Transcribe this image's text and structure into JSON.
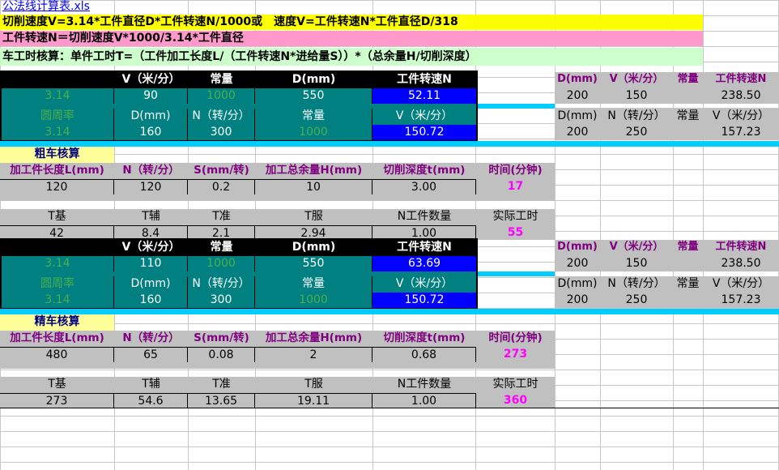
{
  "file_link": "公法线计算表.xls",
  "formula_lines": [
    "切削速度V=3.14*工件直径D*工件转速N/1000或　速度V=工件转速N*工件直径D/318",
    "工件转速N＝切削速度V*1000/3.14*工件直径",
    "车工时核算：单件工时T=（工件加工长度L/（工件转速N*进给量S））*（总余量H/切削深度）"
  ],
  "calc_header": [
    "V（米/分）",
    "常量",
    "D(mm)",
    "工件转速N"
  ],
  "calc_sub_header": [
    "圆周率",
    "D(mm)",
    "N（转/分）",
    "常量",
    "V（米/分）"
  ],
  "side_header1": [
    "D(mm)",
    "V（米/分）",
    "常量",
    "工件转速N"
  ],
  "side_header2": [
    "D(mm)",
    "N（转/分）",
    "常量",
    "V（米/分）"
  ],
  "rough": {
    "title": "粗车核算",
    "calc1": [
      "3.14",
      "90",
      "1000",
      "550",
      "52.11"
    ],
    "calc2": [
      "3.14",
      "160",
      "300",
      "1000",
      "150.72"
    ],
    "side1": [
      "200",
      "150",
      "",
      "238.50"
    ],
    "side2": [
      "200",
      "250",
      "",
      "157.23"
    ],
    "headers": [
      "加工件长度L(mm)",
      "N（转/分）",
      "S(mm/转)",
      "加工总余量H(mm)",
      "切削深度t(mm)",
      "时间(分钟)"
    ],
    "values": [
      "120",
      "120",
      "0.2",
      "10",
      "3.00",
      "17"
    ],
    "t_headers": [
      "T基",
      "T辅",
      "T准",
      "T服",
      "N工件数量",
      "实际工时"
    ],
    "t_values": [
      "42",
      "8.4",
      "2.1",
      "2.94",
      "1.00",
      "55"
    ]
  },
  "finish": {
    "title": "精车核算",
    "calc1": [
      "3.14",
      "110",
      "1000",
      "550",
      "63.69"
    ],
    "calc2": [
      "3.14",
      "160",
      "300",
      "1000",
      "150.72"
    ],
    "side1": [
      "200",
      "150",
      "",
      "238.50"
    ],
    "side2": [
      "200",
      "250",
      "",
      "157.23"
    ],
    "headers": [
      "加工件长度L(mm)",
      "N（转/分）",
      "S(mm/转)",
      "加工总余量H(mm)",
      "切削深度t(mm)",
      "时间(分钟)"
    ],
    "values": [
      "480",
      "65",
      "0.08",
      "2",
      "0.68",
      "273"
    ],
    "t_headers": [
      "T基",
      "T辅",
      "T准",
      "T服",
      "N工件数量",
      "实际工时"
    ],
    "t_values": [
      "273",
      "54.6",
      "13.65",
      "19.11",
      "1.00",
      "360"
    ]
  },
  "colors": {
    "formula1_bg": "#ffff00",
    "formula2_bg": "#ff99cc",
    "formula3_bg": "#ccffcc",
    "calc_header_bg": "#000000",
    "calc_row_bg": "#008080",
    "result_bg": "#0000ff",
    "separator": "#00ccff",
    "block_bg": "#c0c0c0",
    "section_title_bg": "#ffff99",
    "time_color": "#ff00ff",
    "header_text": "#800080"
  }
}
